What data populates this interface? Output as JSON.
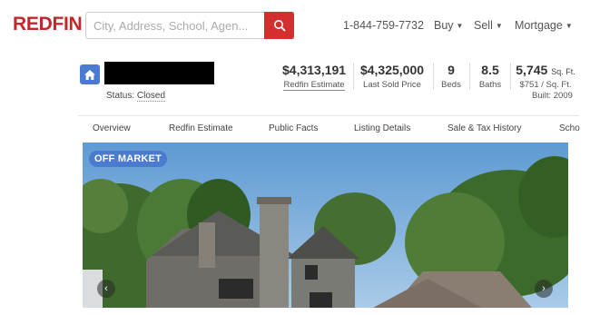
{
  "header": {
    "logo": "REDFIN",
    "search_placeholder": "City, Address, School, Agen...",
    "phone": "1-844-759-7732",
    "nav": [
      {
        "label": "Buy"
      },
      {
        "label": "Sell"
      },
      {
        "label": "Mortgage"
      }
    ]
  },
  "summary": {
    "status_label": "Status:",
    "status_value": "Closed",
    "estimate_value": "$4,313,191",
    "estimate_label": "Redfin Estimate",
    "sold_value": "$4,325,000",
    "sold_label": "Last Sold Price",
    "beds_value": "9",
    "beds_label": "Beds",
    "baths_value": "8.5",
    "baths_label": "Baths",
    "sqft_value": "5,745",
    "sqft_unit": "Sq. Ft.",
    "sqft_price": "$751 / Sq. Ft.",
    "built": "Built: 2009"
  },
  "tabs": [
    "Overview",
    "Redfin Estimate",
    "Public Facts",
    "Listing Details",
    "Sale & Tax History",
    "Scho"
  ],
  "photo": {
    "badge": "OFF MARKET"
  }
}
